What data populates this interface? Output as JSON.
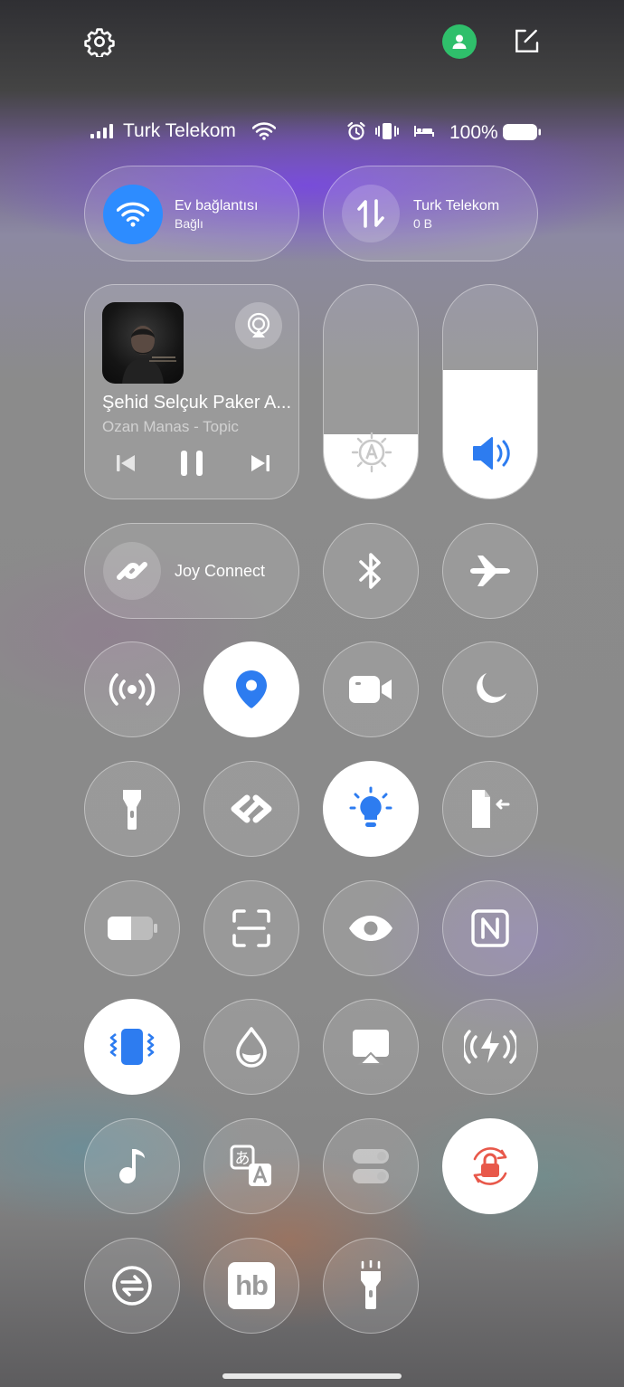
{
  "status_bar": {
    "carrier": "Turk Telekom",
    "battery_percent": "100%",
    "battery_level": 1.0
  },
  "top_bar": {
    "settings_icon": "gear-icon",
    "account_icon": "person-icon",
    "edit_icon": "edit-icon",
    "account_color": "#2fbf6b"
  },
  "wifi_tile": {
    "title": "Ev bağlantısı",
    "subtitle": "Bağlı",
    "active": true,
    "accent": "#2d8cff"
  },
  "data_tile": {
    "title": "Turk Telekom",
    "subtitle": "0 B",
    "active": false
  },
  "media": {
    "song_title": "Şehid Selçuk Paker A...",
    "artist": "Ozan Manas - Topic",
    "state": "playing"
  },
  "sliders": {
    "brightness_level": 0.3,
    "brightness_icon": "auto-brightness-icon",
    "volume_level": 0.6,
    "volume_icon": "speaker-icon"
  },
  "joy_connect": {
    "label": "Joy Connect"
  },
  "toggles": [
    {
      "name": "bluetooth",
      "icon": "bluetooth-icon",
      "active": false
    },
    {
      "name": "airplane-mode",
      "icon": "airplane-icon",
      "active": false
    },
    {
      "name": "hotspot",
      "icon": "hotspot-icon",
      "active": false
    },
    {
      "name": "location",
      "icon": "location-icon",
      "active": true
    },
    {
      "name": "screen-record",
      "icon": "video-camera-icon",
      "active": false
    },
    {
      "name": "do-not-disturb",
      "icon": "moon-icon",
      "active": false
    },
    {
      "name": "flashlight",
      "icon": "flashlight-icon",
      "active": false
    },
    {
      "name": "link-share",
      "icon": "link-icon",
      "active": false
    },
    {
      "name": "eye-protection-light",
      "icon": "lightbulb-icon",
      "active": true
    },
    {
      "name": "smart-sidebar",
      "icon": "sidebar-icon",
      "active": false
    },
    {
      "name": "battery-saver",
      "icon": "battery-icon",
      "active": false
    },
    {
      "name": "screenshot",
      "icon": "screenshot-frame-icon",
      "active": false
    },
    {
      "name": "eye-comfort",
      "icon": "eye-icon",
      "active": false
    },
    {
      "name": "nfc",
      "icon": "nfc-icon",
      "active": false
    },
    {
      "name": "vibrate",
      "icon": "vibrate-icon",
      "active": true
    },
    {
      "name": "water-eject",
      "icon": "water-drop-icon",
      "active": false
    },
    {
      "name": "screen-cast",
      "icon": "screencast-icon",
      "active": false
    },
    {
      "name": "power-share",
      "icon": "power-wireless-icon",
      "active": false
    },
    {
      "name": "music-recognition",
      "icon": "music-note-icon",
      "active": false
    },
    {
      "name": "translate",
      "icon": "translate-icon",
      "active": false
    },
    {
      "name": "toggle-switches",
      "icon": "switches-icon",
      "active": false
    },
    {
      "name": "rotation-lock",
      "icon": "rotation-lock-icon",
      "active": true
    },
    {
      "name": "data-switch",
      "icon": "transfer-icon",
      "active": false
    },
    {
      "name": "hb-app",
      "icon": "hb-logo-icon",
      "label": "hb",
      "active": false
    },
    {
      "name": "torch",
      "icon": "torch-icon",
      "active": false
    }
  ]
}
